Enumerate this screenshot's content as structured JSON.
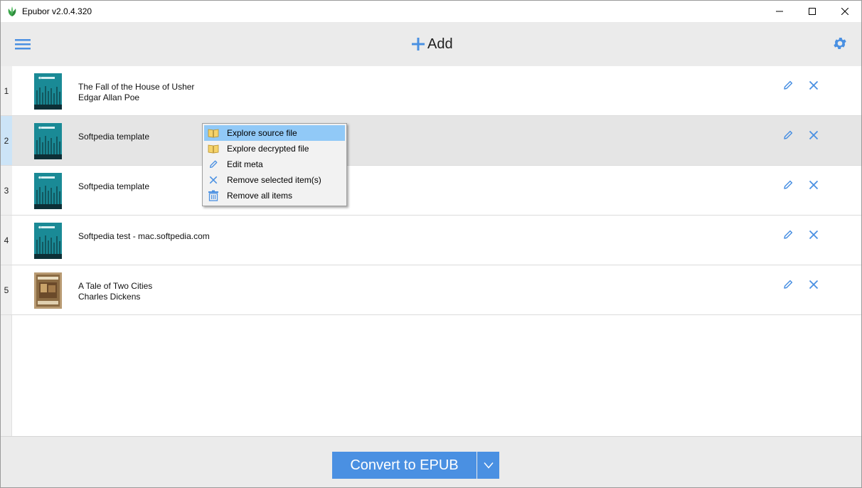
{
  "window": {
    "title": "Epubor v2.0.4.320"
  },
  "toolbar": {
    "menu_icon": "hamburger-menu-icon",
    "add_label": "Add",
    "add_icon": "plus-icon",
    "settings_icon": "gear-icon"
  },
  "books": [
    {
      "index": "1",
      "title": "The Fall of the House of Usher",
      "author": "Edgar Allan Poe",
      "cover": "teal-cover"
    },
    {
      "index": "2",
      "title": "Softpedia template",
      "author": "",
      "cover": "teal-cover",
      "selected": true
    },
    {
      "index": "3",
      "title": "Softpedia template",
      "author": "",
      "cover": "teal-cover"
    },
    {
      "index": "4",
      "title": "Softpedia test - mac.softpedia.com",
      "author": "",
      "cover": "teal-cover"
    },
    {
      "index": "5",
      "title": "A Tale of Two Cities",
      "author": "Charles Dickens",
      "cover": "vintage-cover"
    }
  ],
  "context_menu": {
    "items": [
      {
        "label": "Explore source file",
        "icon": "book-icon",
        "highlighted": true
      },
      {
        "label": "Explore decrypted file",
        "icon": "book-icon"
      },
      {
        "label": "Edit meta",
        "icon": "pencil-icon"
      },
      {
        "label": "Remove selected item(s)",
        "icon": "close-icon"
      },
      {
        "label": "Remove all items",
        "icon": "trash-icon"
      }
    ]
  },
  "footer": {
    "convert_label": "Convert to EPUB",
    "dropdown_icon": "chevron-down-icon"
  },
  "colors": {
    "accent": "#4a90e2",
    "toolbar_bg": "#ebebeb",
    "selected_row": "#e5e5e5",
    "menu_highlight": "#91c9f7",
    "cover_teal": "#1a8a96"
  }
}
